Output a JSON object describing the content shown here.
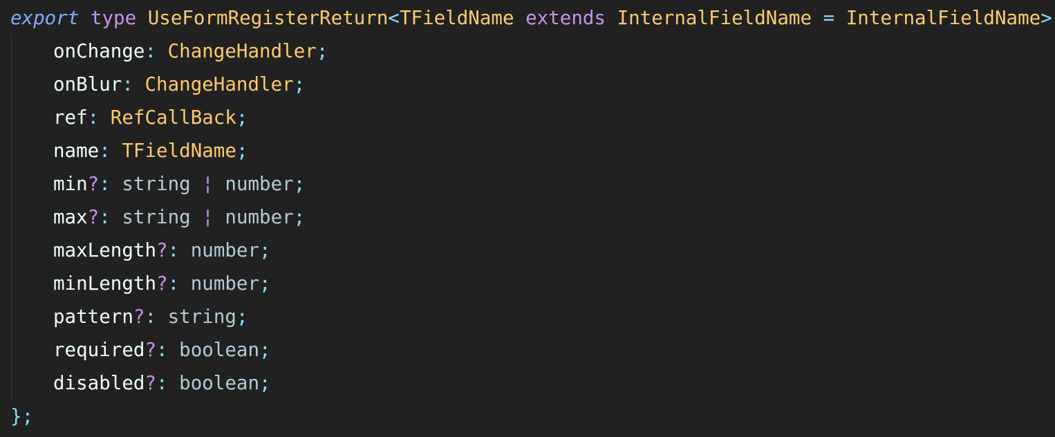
{
  "theme": {
    "background": "#212121",
    "keyword": "#c792ea",
    "export": "#82aaff",
    "type_name": "#ffcb6b",
    "punct": "#89ddff",
    "property": "#eeffff",
    "builtin": "#b2ccd6",
    "optional": "#c792ea"
  },
  "code": {
    "lines": [
      {
        "tokens": [
          {
            "text": "export",
            "role": "export",
            "italic": true
          },
          {
            "text": " ",
            "role": "plain"
          },
          {
            "text": "type",
            "role": "keyword"
          },
          {
            "text": " ",
            "role": "plain"
          },
          {
            "text": "UseFormRegisterReturn",
            "role": "type_name"
          },
          {
            "text": "<",
            "role": "punct"
          },
          {
            "text": "TFieldName",
            "role": "type_name"
          },
          {
            "text": " ",
            "role": "plain"
          },
          {
            "text": "extends",
            "role": "keyword"
          },
          {
            "text": " ",
            "role": "plain"
          },
          {
            "text": "InternalFieldName",
            "role": "type_name"
          },
          {
            "text": " ",
            "role": "plain"
          },
          {
            "text": "=",
            "role": "punct"
          },
          {
            "text": " ",
            "role": "plain"
          },
          {
            "text": "InternalFieldName",
            "role": "type_name"
          },
          {
            "text": ">",
            "role": "punct"
          },
          {
            "text": " ",
            "role": "plain"
          },
          {
            "text": "=",
            "role": "punct"
          },
          {
            "text": " ",
            "role": "plain"
          },
          {
            "text": "{",
            "role": "punct"
          }
        ]
      },
      {
        "indent": true,
        "tokens": [
          {
            "text": "onChange",
            "role": "property"
          },
          {
            "text": ":",
            "role": "punct"
          },
          {
            "text": " ",
            "role": "plain"
          },
          {
            "text": "ChangeHandler",
            "role": "type_name"
          },
          {
            "text": ";",
            "role": "punct"
          }
        ]
      },
      {
        "indent": true,
        "tokens": [
          {
            "text": "onBlur",
            "role": "property"
          },
          {
            "text": ":",
            "role": "punct"
          },
          {
            "text": " ",
            "role": "plain"
          },
          {
            "text": "ChangeHandler",
            "role": "type_name"
          },
          {
            "text": ";",
            "role": "punct"
          }
        ]
      },
      {
        "indent": true,
        "tokens": [
          {
            "text": "ref",
            "role": "property"
          },
          {
            "text": ":",
            "role": "punct"
          },
          {
            "text": " ",
            "role": "plain"
          },
          {
            "text": "RefCallBack",
            "role": "type_name"
          },
          {
            "text": ";",
            "role": "punct"
          }
        ]
      },
      {
        "indent": true,
        "tokens": [
          {
            "text": "name",
            "role": "property"
          },
          {
            "text": ":",
            "role": "punct"
          },
          {
            "text": " ",
            "role": "plain"
          },
          {
            "text": "TFieldName",
            "role": "type_name"
          },
          {
            "text": ";",
            "role": "punct"
          }
        ]
      },
      {
        "indent": true,
        "tokens": [
          {
            "text": "min",
            "role": "property"
          },
          {
            "text": "?",
            "role": "optional"
          },
          {
            "text": ":",
            "role": "punct"
          },
          {
            "text": " ",
            "role": "plain"
          },
          {
            "text": "string",
            "role": "builtin"
          },
          {
            "text": " ",
            "role": "plain"
          },
          {
            "text": "¦",
            "role": "optional"
          },
          {
            "text": " ",
            "role": "plain"
          },
          {
            "text": "number",
            "role": "builtin"
          },
          {
            "text": ";",
            "role": "punct"
          }
        ]
      },
      {
        "indent": true,
        "tokens": [
          {
            "text": "max",
            "role": "property"
          },
          {
            "text": "?",
            "role": "optional"
          },
          {
            "text": ":",
            "role": "punct"
          },
          {
            "text": " ",
            "role": "plain"
          },
          {
            "text": "string",
            "role": "builtin"
          },
          {
            "text": " ",
            "role": "plain"
          },
          {
            "text": "¦",
            "role": "optional"
          },
          {
            "text": " ",
            "role": "plain"
          },
          {
            "text": "number",
            "role": "builtin"
          },
          {
            "text": ";",
            "role": "punct"
          }
        ]
      },
      {
        "indent": true,
        "tokens": [
          {
            "text": "maxLength",
            "role": "property"
          },
          {
            "text": "?",
            "role": "optional"
          },
          {
            "text": ":",
            "role": "punct"
          },
          {
            "text": " ",
            "role": "plain"
          },
          {
            "text": "number",
            "role": "builtin"
          },
          {
            "text": ";",
            "role": "punct"
          }
        ]
      },
      {
        "indent": true,
        "tokens": [
          {
            "text": "minLength",
            "role": "property"
          },
          {
            "text": "?",
            "role": "optional"
          },
          {
            "text": ":",
            "role": "punct"
          },
          {
            "text": " ",
            "role": "plain"
          },
          {
            "text": "number",
            "role": "builtin"
          },
          {
            "text": ";",
            "role": "punct"
          }
        ]
      },
      {
        "indent": true,
        "tokens": [
          {
            "text": "pattern",
            "role": "property"
          },
          {
            "text": "?",
            "role": "optional"
          },
          {
            "text": ":",
            "role": "punct"
          },
          {
            "text": " ",
            "role": "plain"
          },
          {
            "text": "string",
            "role": "builtin"
          },
          {
            "text": ";",
            "role": "punct"
          }
        ]
      },
      {
        "indent": true,
        "tokens": [
          {
            "text": "required",
            "role": "property"
          },
          {
            "text": "?",
            "role": "optional"
          },
          {
            "text": ":",
            "role": "punct"
          },
          {
            "text": " ",
            "role": "plain"
          },
          {
            "text": "boolean",
            "role": "builtin"
          },
          {
            "text": ";",
            "role": "punct"
          }
        ]
      },
      {
        "indent": true,
        "tokens": [
          {
            "text": "disabled",
            "role": "property"
          },
          {
            "text": "?",
            "role": "optional"
          },
          {
            "text": ":",
            "role": "punct"
          },
          {
            "text": " ",
            "role": "plain"
          },
          {
            "text": "boolean",
            "role": "builtin"
          },
          {
            "text": ";",
            "role": "punct"
          }
        ]
      },
      {
        "tokens": [
          {
            "text": "}",
            "role": "punct"
          },
          {
            "text": ";",
            "role": "punct"
          }
        ]
      }
    ]
  }
}
